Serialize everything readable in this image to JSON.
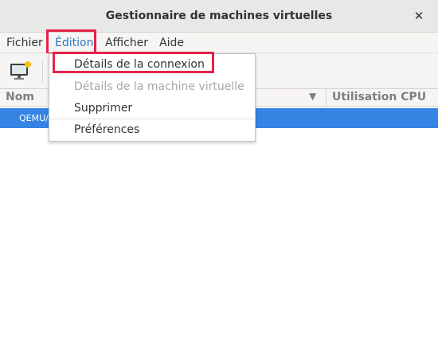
{
  "window": {
    "title": "Gestionnaire de machines virtuelles",
    "close_glyph": "✕"
  },
  "menubar": {
    "items": [
      {
        "label": "Fichier"
      },
      {
        "label": "Édition",
        "active": true
      },
      {
        "label": "Afficher"
      },
      {
        "label": "Aide"
      }
    ]
  },
  "toolbar": {
    "new_vm_icon": "computer-new-icon"
  },
  "columns": {
    "name": "Nom",
    "cpu": "Utilisation CPU"
  },
  "list": {
    "selected_row": "QEMU/"
  },
  "edit_menu": {
    "items": [
      {
        "label": "Détails de la connexion",
        "enabled": true
      },
      {
        "label": "Détails de la machine virtuelle",
        "enabled": false
      },
      {
        "label": "Supprimer",
        "enabled": true
      },
      {
        "label": "Préférences",
        "enabled": true
      }
    ]
  },
  "colors": {
    "accent": "#3584e4",
    "highlight_box": "#e5234b",
    "active_menu_text": "#2a76c6"
  }
}
